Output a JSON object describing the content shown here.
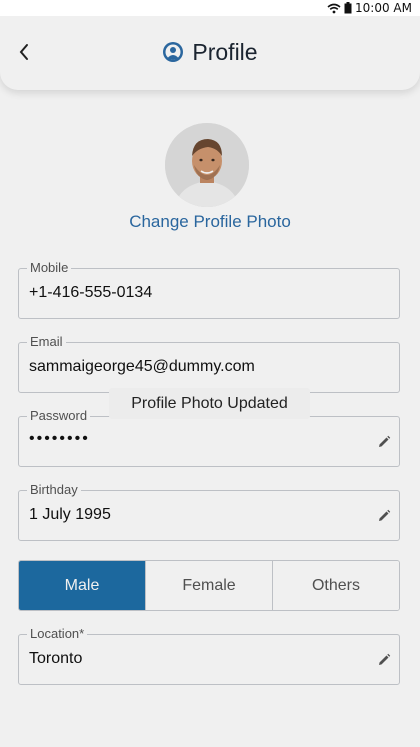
{
  "status_bar": {
    "time": "10:00 AM"
  },
  "header": {
    "title": "Profile"
  },
  "profile": {
    "change_photo_label": "Change Profile Photo"
  },
  "fields": {
    "mobile": {
      "label": "Mobile",
      "value": "+1-416-555-0134"
    },
    "email": {
      "label": "Email",
      "value": "sammaigeorge45@dummy.com"
    },
    "password": {
      "label": "Password",
      "value": "••••••••"
    },
    "birthday": {
      "label": "Birthday",
      "value": "1 July 1995"
    },
    "location": {
      "label": "Location*",
      "value": "Toronto"
    }
  },
  "gender": {
    "options": [
      "Male",
      "Female",
      "Others"
    ],
    "selected": "Male"
  },
  "toast": {
    "message": "Profile Photo Updated"
  },
  "colors": {
    "accent": "#1e6fa8",
    "link": "#2d6da8"
  }
}
